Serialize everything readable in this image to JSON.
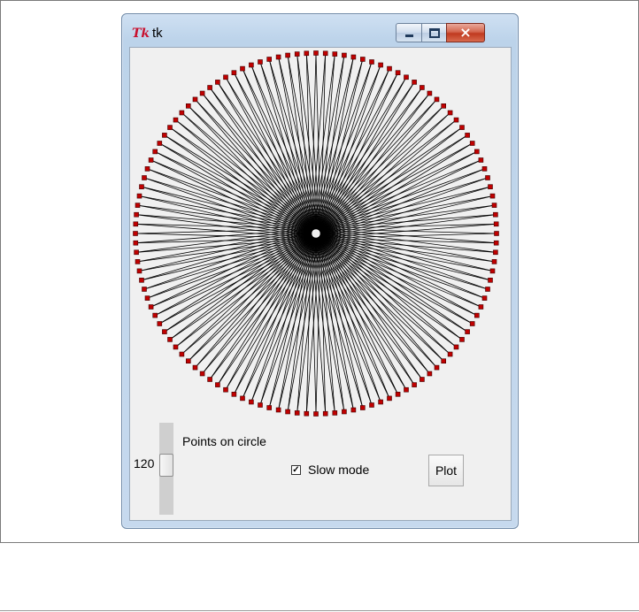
{
  "window": {
    "title": "tk",
    "logo_text": "Tk",
    "controls": {
      "minimize": "minimize",
      "maximize": "maximize",
      "close": "×"
    }
  },
  "canvas": {
    "points_on_circle": 120,
    "line_color": "#000000",
    "point_color": "#c00000",
    "background": "#f0f0f0"
  },
  "controls": {
    "scale_value": "120",
    "scale_label": "Points on circle",
    "slow_mode_label": "Slow mode",
    "slow_mode_checked": true,
    "check_glyph": "✓",
    "plot_label": "Plot"
  }
}
